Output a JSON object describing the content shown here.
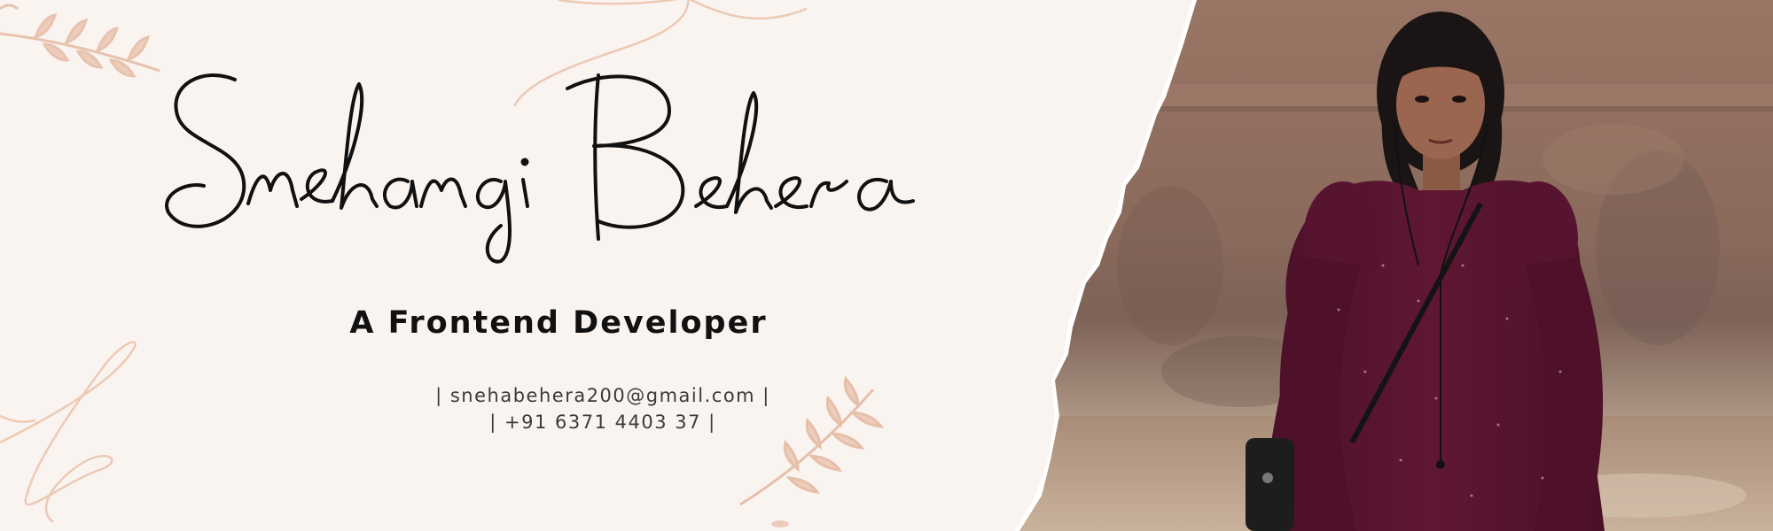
{
  "banner": {
    "name": "Snehangi Behera",
    "role": "A Frontend Developer",
    "email_line": "| snehabehera200@gmail.com |",
    "phone_line": "| +91 6371 4403 37 |"
  },
  "colors": {
    "background": "#faf4f1",
    "accent_decor": "#ecc9b4",
    "text": "#111111",
    "dress": "#5a1530",
    "wall": "#8c6a58"
  }
}
